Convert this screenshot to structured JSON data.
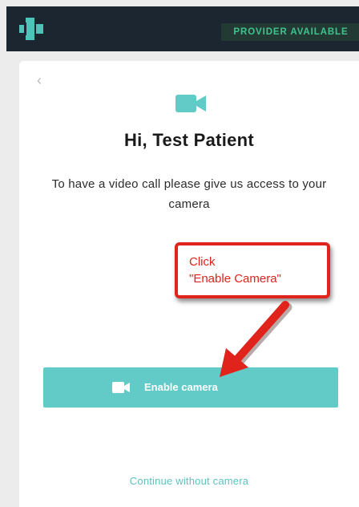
{
  "header": {
    "status_label": "PROVIDER AVAILABLE",
    "logo_icon": "tablet-cross-logo",
    "status_color": "#3ec48f"
  },
  "card": {
    "back_icon": "chevron-left-icon",
    "camera_icon": "video-camera-icon",
    "title": "Hi, Test Patient",
    "subtitle": "To have a video call please give us access to your camera",
    "enable_button_label": "Enable camera",
    "continue_link": "Continue without camera",
    "accent_color": "#62cbc7"
  },
  "annotation": {
    "line1": "Click",
    "line2": "\"Enable Camera\"",
    "color": "#e0231b"
  }
}
